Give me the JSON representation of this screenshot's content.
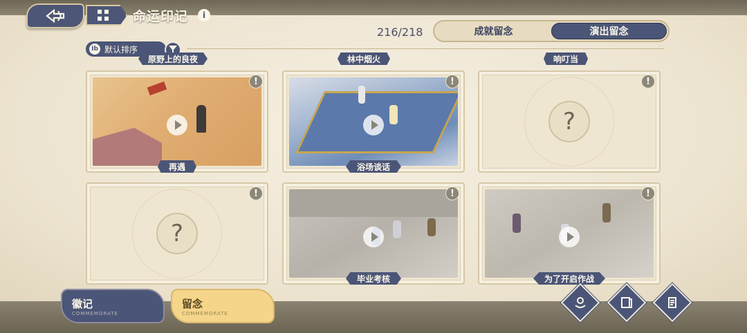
{
  "header": {
    "title": "命运印记",
    "counter": "216/218",
    "tabs": [
      {
        "label": "成就留念",
        "active": false
      },
      {
        "label": "演出留念",
        "active": true
      }
    ],
    "sort_label": "默认排序",
    "sort_icon_text": "Ib"
  },
  "row_labels": [
    "原野上的良夜",
    "林中烟火",
    "响叮当"
  ],
  "cards": [
    {
      "caption": "再遇",
      "unlocked": true
    },
    {
      "caption": "浴场谈话",
      "unlocked": true
    },
    {
      "caption": "",
      "unlocked": false
    },
    {
      "caption": "",
      "unlocked": false
    },
    {
      "caption": "毕业考核",
      "unlocked": true
    },
    {
      "caption": "为了开启作战",
      "unlocked": true
    }
  ],
  "nav": {
    "badge": {
      "label": "徽记",
      "sub": "COMMEMORATE"
    },
    "memory": {
      "label": "留念",
      "sub": "COMMEMORATE"
    }
  },
  "icons": [
    "back-arrow-icon",
    "menu-grid-icon",
    "info-icon",
    "filter-icon",
    "play-icon",
    "question-icon",
    "alert-icon",
    "hand-flower-icon",
    "book-icon",
    "scroll-icon"
  ],
  "colors": {
    "accent": "#4b5577",
    "paper": "#efe7d6",
    "highlight": "#f4d58a"
  }
}
